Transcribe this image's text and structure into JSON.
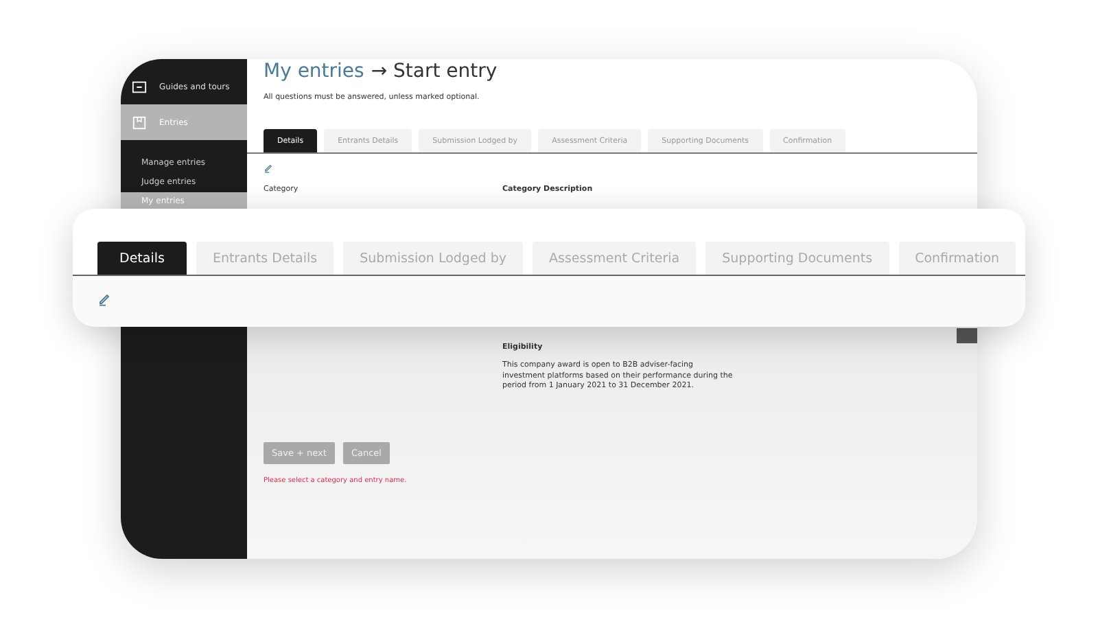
{
  "sidebar": {
    "items": [
      {
        "label": "Guides and tours",
        "kind": "section",
        "selected": false
      },
      {
        "label": "Entries",
        "kind": "section",
        "selected": true
      },
      {
        "label": "Manage entries",
        "kind": "sub",
        "selected": false
      },
      {
        "label": "Judge entries",
        "kind": "sub",
        "selected": false
      },
      {
        "label": "My entries",
        "kind": "sub",
        "selected": true
      }
    ]
  },
  "page": {
    "breadcrumb_link": "My entries",
    "breadcrumb_arrow": "→",
    "title": "Start entry",
    "intro": "All questions must be answered, unless marked optional."
  },
  "tabs": [
    {
      "label": "Details",
      "selected": true
    },
    {
      "label": "Entrants Details",
      "selected": false
    },
    {
      "label": "Submission Lodged by",
      "selected": false
    },
    {
      "label": "Assessment Criteria",
      "selected": false
    },
    {
      "label": "Supporting Documents",
      "selected": false
    },
    {
      "label": "Confirmation",
      "selected": false
    }
  ],
  "form": {
    "category_label": "Category",
    "description_heading": "Category Description",
    "eligibility_heading": "Eligibility",
    "eligibility_text": "This company award is open to B2B adviser-facing investment platforms based on their performance during the period from 1 January 2021 to 31 December 2021."
  },
  "buttons": [
    {
      "label": "Save + next",
      "disabled": true
    },
    {
      "label": "Cancel",
      "disabled": true
    }
  ],
  "error": "Please select a category and entry name.",
  "zoomed_tabs": [
    {
      "label": "Details",
      "selected": true
    },
    {
      "label": "Entrants Details",
      "selected": false
    },
    {
      "label": "Submission Lodged by",
      "selected": false
    },
    {
      "label": "Assessment Criteria",
      "selected": false
    },
    {
      "label": "Supporting Documents",
      "selected": false
    },
    {
      "label": "Confirmation",
      "selected": false
    }
  ]
}
